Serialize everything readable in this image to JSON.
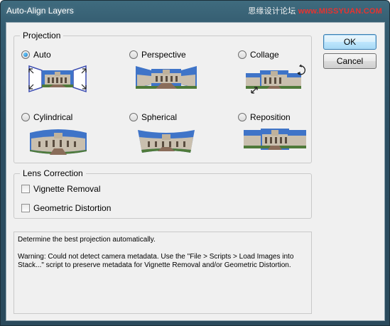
{
  "window": {
    "title": "Auto-Align Layers"
  },
  "watermark": {
    "left": "思缘设计论坛",
    "right": "www.MISSYUAN.COM"
  },
  "projection": {
    "label": "Projection",
    "options": [
      {
        "label": "Auto",
        "selected": true
      },
      {
        "label": "Perspective",
        "selected": false
      },
      {
        "label": "Collage",
        "selected": false
      },
      {
        "label": "Cylindrical",
        "selected": false
      },
      {
        "label": "Spherical",
        "selected": false
      },
      {
        "label": "Reposition",
        "selected": false
      }
    ]
  },
  "lens_correction": {
    "label": "Lens Correction",
    "options": [
      {
        "label": "Vignette Removal",
        "checked": false
      },
      {
        "label": "Geometric Distortion",
        "checked": false
      }
    ]
  },
  "buttons": {
    "ok": "OK",
    "cancel": "Cancel"
  },
  "description": {
    "line1": "Determine the best projection automatically.",
    "line2": "Warning: Could not detect camera metadata. Use the \"File > Scripts > Load Images into Stack...\" script to preserve metadata for Vignette Removal and/or Geometric Distortion."
  },
  "colors": {
    "sky": "#3f74c8",
    "building": "#c9bfae",
    "grass": "#4f7a3a",
    "path": "#8a6d5a"
  }
}
